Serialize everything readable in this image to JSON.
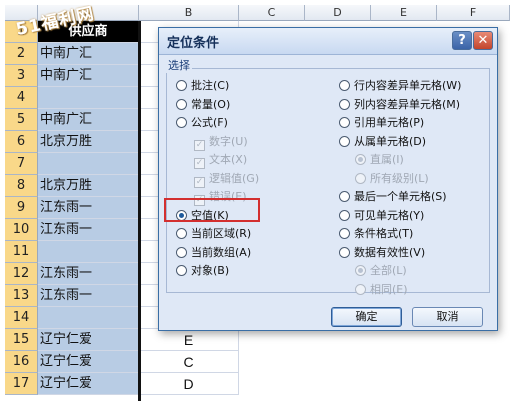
{
  "watermark": "51福利网",
  "columns": [
    "A",
    "B",
    "C",
    "D",
    "E",
    "F"
  ],
  "rows": [
    {
      "num": "1",
      "a": "供应商",
      "b": ""
    },
    {
      "num": "2",
      "a": "中南广汇",
      "b": ""
    },
    {
      "num": "3",
      "a": "中南广汇",
      "b": ""
    },
    {
      "num": "4",
      "a": "",
      "b": ""
    },
    {
      "num": "5",
      "a": "中南广汇",
      "b": ""
    },
    {
      "num": "6",
      "a": "北京万胜",
      "b": ""
    },
    {
      "num": "7",
      "a": "",
      "b": ""
    },
    {
      "num": "8",
      "a": "北京万胜",
      "b": ""
    },
    {
      "num": "9",
      "a": "江东雨一",
      "b": ""
    },
    {
      "num": "10",
      "a": "江东雨一",
      "b": ""
    },
    {
      "num": "11",
      "a": "",
      "b": ""
    },
    {
      "num": "12",
      "a": "江东雨一",
      "b": ""
    },
    {
      "num": "13",
      "a": "江东雨一",
      "b": ""
    },
    {
      "num": "14",
      "a": "",
      "b": ""
    },
    {
      "num": "15",
      "a": "辽宁仁爱",
      "b": "E"
    },
    {
      "num": "16",
      "a": "辽宁仁爱",
      "b": "C"
    },
    {
      "num": "17",
      "a": "辽宁仁爱",
      "b": "D"
    }
  ],
  "dialog": {
    "title": "定位条件",
    "help": "?",
    "close": "✕",
    "group_label": "选择",
    "left_options": [
      {
        "label": "批注(C)",
        "state": "normal"
      },
      {
        "label": "常量(O)",
        "state": "normal"
      },
      {
        "label": "公式(F)",
        "state": "normal"
      },
      {
        "label": "数字(U)",
        "state": "check-disabled"
      },
      {
        "label": "文本(X)",
        "state": "check-disabled"
      },
      {
        "label": "逻辑值(G)",
        "state": "check-disabled"
      },
      {
        "label": "错误(E)",
        "state": "check-disabled"
      },
      {
        "label": "空值(K)",
        "state": "selected"
      },
      {
        "label": "当前区域(R)",
        "state": "normal"
      },
      {
        "label": "当前数组(A)",
        "state": "normal"
      },
      {
        "label": "对象(B)",
        "state": "normal"
      }
    ],
    "right_options": [
      {
        "label": "行内容差异单元格(W)",
        "state": "normal"
      },
      {
        "label": "列内容差异单元格(M)",
        "state": "normal"
      },
      {
        "label": "引用单元格(P)",
        "state": "normal"
      },
      {
        "label": "从属单元格(D)",
        "state": "normal"
      },
      {
        "label": "直属(I)",
        "state": "disabled-on"
      },
      {
        "label": "所有级别(L)",
        "state": "disabled"
      },
      {
        "label": "最后一个单元格(S)",
        "state": "normal"
      },
      {
        "label": "可见单元格(Y)",
        "state": "normal"
      },
      {
        "label": "条件格式(T)",
        "state": "normal"
      },
      {
        "label": "数据有效性(V)",
        "state": "normal"
      },
      {
        "label": "全部(L)",
        "state": "disabled-on"
      },
      {
        "label": "相同(E)",
        "state": "disabled"
      }
    ],
    "ok_label": "确定",
    "cancel_label": "取消"
  }
}
